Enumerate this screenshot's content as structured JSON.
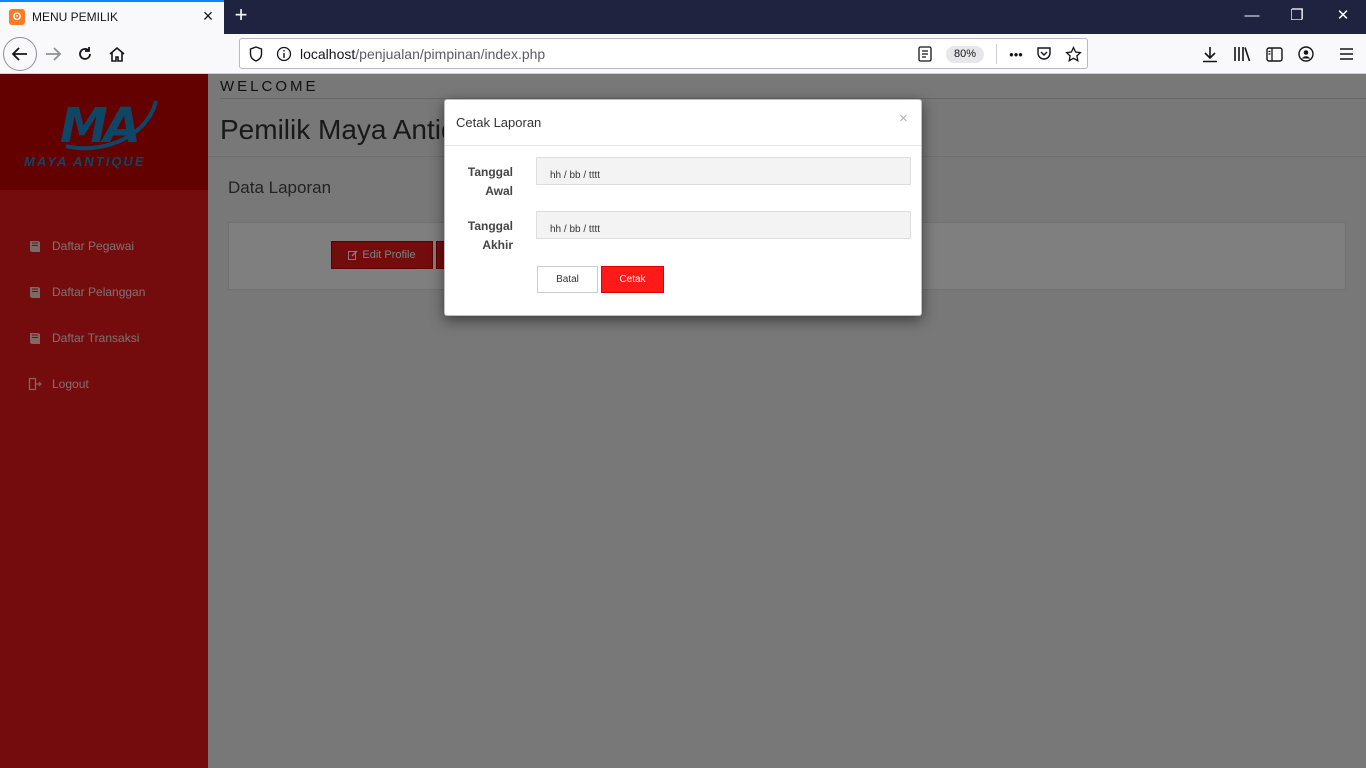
{
  "browser": {
    "tab_title": "MENU PEMILIK",
    "tab_close": "×",
    "new_tab": "+",
    "window_controls": {
      "minimize": "—",
      "restore": "❐",
      "close": "✕"
    },
    "url_host": "localhost",
    "url_path": "/penjualan/pimpinan/index.php",
    "zoom": "80%",
    "more": "•••"
  },
  "sidebar": {
    "logo_text": "MA",
    "logo_sub": "MAYA ANTIQUE",
    "items": [
      {
        "label": "Daftar Pegawai",
        "icon": "book-icon"
      },
      {
        "label": "Daftar Pelanggan",
        "icon": "book-icon"
      },
      {
        "label": "Daftar Transaksi",
        "icon": "book-icon"
      },
      {
        "label": "Logout",
        "icon": "logout-icon"
      }
    ]
  },
  "main": {
    "welcome": "WELCOME",
    "title": "Pemilik Maya Antiq",
    "section_title": "Data Laporan",
    "edit_profile": "Edit Profile"
  },
  "modal": {
    "title": "Cetak Laporan",
    "close": "×",
    "fields": [
      {
        "label_line1": "Tanggal",
        "label_line2": "Awal",
        "placeholder": "hh / bb / tttt"
      },
      {
        "label_line1": "Tanggal",
        "label_line2": "Akhir",
        "placeholder": "hh / bb / tttt"
      }
    ],
    "cancel_label": "Batal",
    "submit_label": "Cetak"
  },
  "colors": {
    "sidebar": "#e8191c",
    "logo_bg": "#c70000",
    "submit": "#ff1a1a",
    "accent_blue": "#1f8ccc"
  }
}
